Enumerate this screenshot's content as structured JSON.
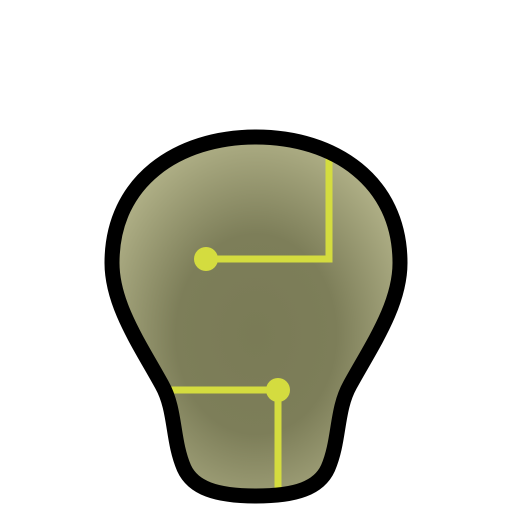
{
  "icon": {
    "name": "lightbulb-circuit-icon"
  },
  "colors": {
    "background": "#ffffff",
    "outline": "#000000",
    "bulb_center": "#7a7b56",
    "bulb_edge": "#b9b98f",
    "circuit": "#d4dc3f"
  }
}
